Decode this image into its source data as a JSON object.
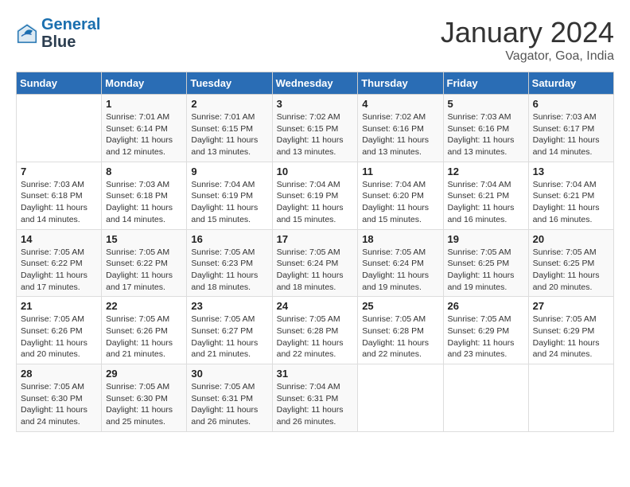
{
  "header": {
    "logo_line1": "General",
    "logo_line2": "Blue",
    "month_title": "January 2024",
    "subtitle": "Vagator, Goa, India"
  },
  "columns": [
    "Sunday",
    "Monday",
    "Tuesday",
    "Wednesday",
    "Thursday",
    "Friday",
    "Saturday"
  ],
  "weeks": [
    [
      {
        "day": "",
        "info": ""
      },
      {
        "day": "1",
        "info": "Sunrise: 7:01 AM\nSunset: 6:14 PM\nDaylight: 11 hours\nand 12 minutes."
      },
      {
        "day": "2",
        "info": "Sunrise: 7:01 AM\nSunset: 6:15 PM\nDaylight: 11 hours\nand 13 minutes."
      },
      {
        "day": "3",
        "info": "Sunrise: 7:02 AM\nSunset: 6:15 PM\nDaylight: 11 hours\nand 13 minutes."
      },
      {
        "day": "4",
        "info": "Sunrise: 7:02 AM\nSunset: 6:16 PM\nDaylight: 11 hours\nand 13 minutes."
      },
      {
        "day": "5",
        "info": "Sunrise: 7:03 AM\nSunset: 6:16 PM\nDaylight: 11 hours\nand 13 minutes."
      },
      {
        "day": "6",
        "info": "Sunrise: 7:03 AM\nSunset: 6:17 PM\nDaylight: 11 hours\nand 14 minutes."
      }
    ],
    [
      {
        "day": "7",
        "info": "Sunrise: 7:03 AM\nSunset: 6:18 PM\nDaylight: 11 hours\nand 14 minutes."
      },
      {
        "day": "8",
        "info": "Sunrise: 7:03 AM\nSunset: 6:18 PM\nDaylight: 11 hours\nand 14 minutes."
      },
      {
        "day": "9",
        "info": "Sunrise: 7:04 AM\nSunset: 6:19 PM\nDaylight: 11 hours\nand 15 minutes."
      },
      {
        "day": "10",
        "info": "Sunrise: 7:04 AM\nSunset: 6:19 PM\nDaylight: 11 hours\nand 15 minutes."
      },
      {
        "day": "11",
        "info": "Sunrise: 7:04 AM\nSunset: 6:20 PM\nDaylight: 11 hours\nand 15 minutes."
      },
      {
        "day": "12",
        "info": "Sunrise: 7:04 AM\nSunset: 6:21 PM\nDaylight: 11 hours\nand 16 minutes."
      },
      {
        "day": "13",
        "info": "Sunrise: 7:04 AM\nSunset: 6:21 PM\nDaylight: 11 hours\nand 16 minutes."
      }
    ],
    [
      {
        "day": "14",
        "info": "Sunrise: 7:05 AM\nSunset: 6:22 PM\nDaylight: 11 hours\nand 17 minutes."
      },
      {
        "day": "15",
        "info": "Sunrise: 7:05 AM\nSunset: 6:22 PM\nDaylight: 11 hours\nand 17 minutes."
      },
      {
        "day": "16",
        "info": "Sunrise: 7:05 AM\nSunset: 6:23 PM\nDaylight: 11 hours\nand 18 minutes."
      },
      {
        "day": "17",
        "info": "Sunrise: 7:05 AM\nSunset: 6:24 PM\nDaylight: 11 hours\nand 18 minutes."
      },
      {
        "day": "18",
        "info": "Sunrise: 7:05 AM\nSunset: 6:24 PM\nDaylight: 11 hours\nand 19 minutes."
      },
      {
        "day": "19",
        "info": "Sunrise: 7:05 AM\nSunset: 6:25 PM\nDaylight: 11 hours\nand 19 minutes."
      },
      {
        "day": "20",
        "info": "Sunrise: 7:05 AM\nSunset: 6:25 PM\nDaylight: 11 hours\nand 20 minutes."
      }
    ],
    [
      {
        "day": "21",
        "info": "Sunrise: 7:05 AM\nSunset: 6:26 PM\nDaylight: 11 hours\nand 20 minutes."
      },
      {
        "day": "22",
        "info": "Sunrise: 7:05 AM\nSunset: 6:26 PM\nDaylight: 11 hours\nand 21 minutes."
      },
      {
        "day": "23",
        "info": "Sunrise: 7:05 AM\nSunset: 6:27 PM\nDaylight: 11 hours\nand 21 minutes."
      },
      {
        "day": "24",
        "info": "Sunrise: 7:05 AM\nSunset: 6:28 PM\nDaylight: 11 hours\nand 22 minutes."
      },
      {
        "day": "25",
        "info": "Sunrise: 7:05 AM\nSunset: 6:28 PM\nDaylight: 11 hours\nand 22 minutes."
      },
      {
        "day": "26",
        "info": "Sunrise: 7:05 AM\nSunset: 6:29 PM\nDaylight: 11 hours\nand 23 minutes."
      },
      {
        "day": "27",
        "info": "Sunrise: 7:05 AM\nSunset: 6:29 PM\nDaylight: 11 hours\nand 24 minutes."
      }
    ],
    [
      {
        "day": "28",
        "info": "Sunrise: 7:05 AM\nSunset: 6:30 PM\nDaylight: 11 hours\nand 24 minutes."
      },
      {
        "day": "29",
        "info": "Sunrise: 7:05 AM\nSunset: 6:30 PM\nDaylight: 11 hours\nand 25 minutes."
      },
      {
        "day": "30",
        "info": "Sunrise: 7:05 AM\nSunset: 6:31 PM\nDaylight: 11 hours\nand 26 minutes."
      },
      {
        "day": "31",
        "info": "Sunrise: 7:04 AM\nSunset: 6:31 PM\nDaylight: 11 hours\nand 26 minutes."
      },
      {
        "day": "",
        "info": ""
      },
      {
        "day": "",
        "info": ""
      },
      {
        "day": "",
        "info": ""
      }
    ]
  ]
}
